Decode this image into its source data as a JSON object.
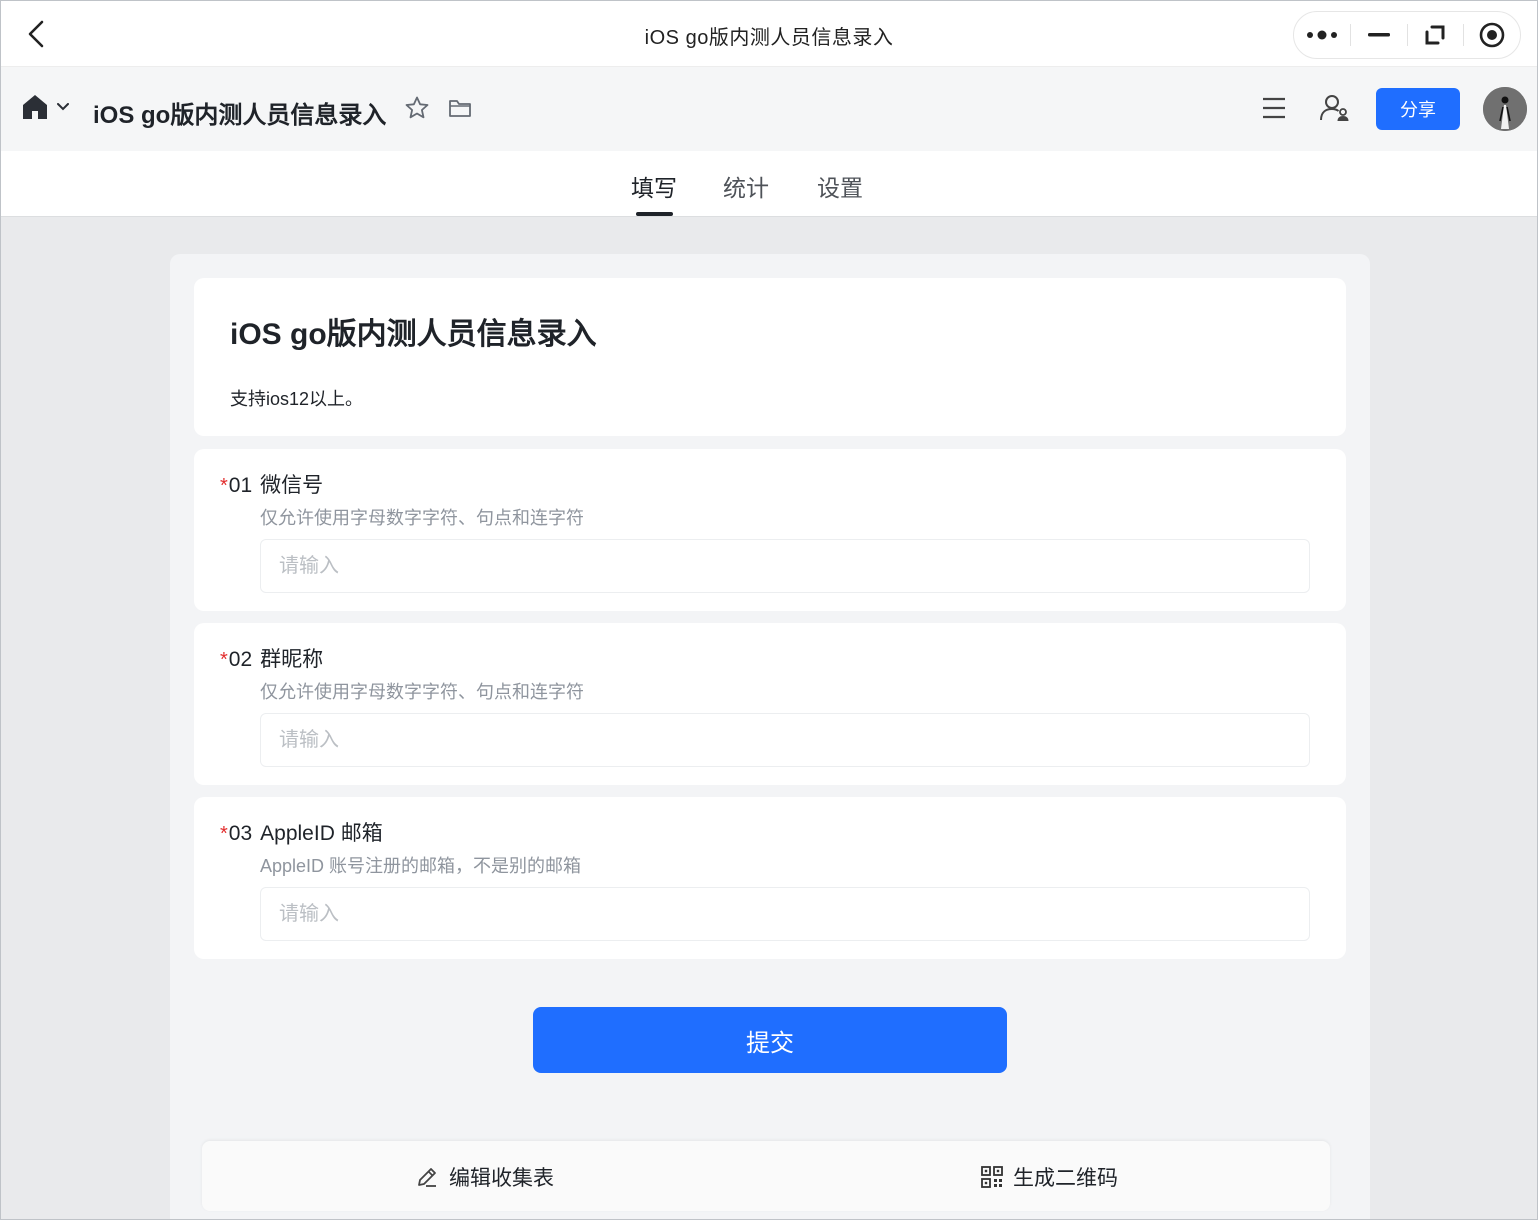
{
  "window": {
    "title": "iOS go版内测人员信息录入"
  },
  "toolbar": {
    "doc_title": "iOS go版内测人员信息录入",
    "share_label": "分享"
  },
  "tabs": [
    {
      "label": "填写",
      "active": true
    },
    {
      "label": "统计",
      "active": false
    },
    {
      "label": "设置",
      "active": false
    }
  ],
  "form": {
    "title": "iOS go版内测人员信息录入",
    "description": "支持ios12以上。",
    "questions": [
      {
        "required_mark": "*",
        "number": "01",
        "label": "微信号",
        "hint": "仅允许使用字母数字字符、句点和连字符",
        "placeholder": "请输入",
        "value": ""
      },
      {
        "required_mark": "*",
        "number": "02",
        "label": "群昵称",
        "hint": "仅允许使用字母数字字符、句点和连字符",
        "placeholder": "请输入",
        "value": ""
      },
      {
        "required_mark": "*",
        "number": "03",
        "label": "AppleID 邮箱",
        "hint": "AppleID 账号注册的邮箱，不是别的邮箱",
        "placeholder": "请输入",
        "value": ""
      }
    ],
    "submit_label": "提交"
  },
  "bottom_bar": {
    "edit_label": "编辑收集表",
    "qrcode_label": "生成二维码"
  },
  "colors": {
    "accent": "#1f6eff",
    "required": "#e22e2e",
    "hint": "#8f959e",
    "page_bg": "#e9eaec"
  },
  "icons": [
    "back-arrow-icon",
    "more-dots-icon",
    "minimize-icon",
    "restore-icon",
    "record-icon",
    "home-icon",
    "chevron-down-icon",
    "star-icon",
    "folder-icon",
    "menu-icon",
    "collaborator-icon",
    "pencil-icon",
    "qrcode-icon"
  ]
}
